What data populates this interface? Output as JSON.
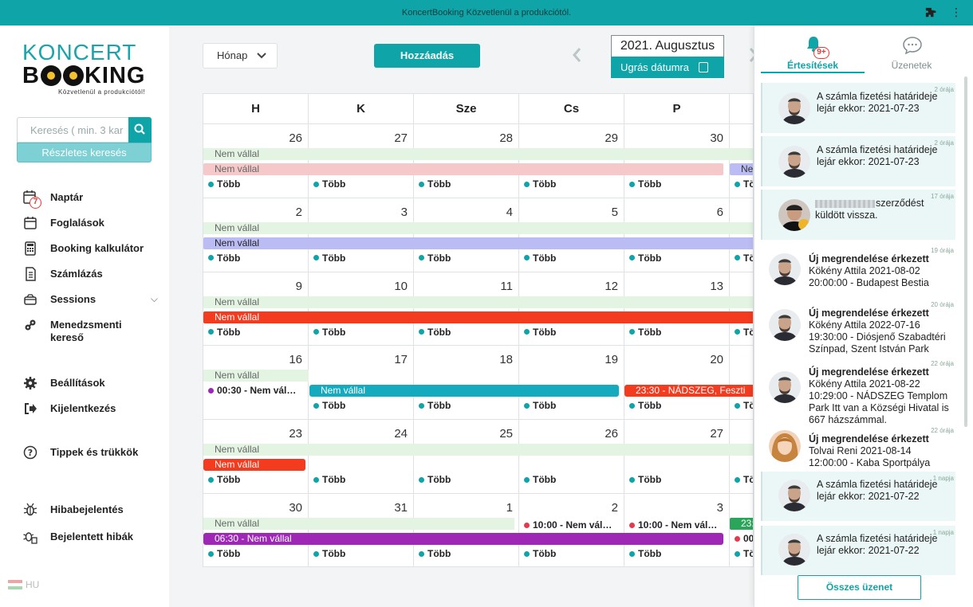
{
  "topbar": {
    "text": "KoncertBooking Közvetlenül a produkciótól.",
    "extension_icon": "puzzle-icon",
    "menu_icon": "kebab-icon"
  },
  "logo": {
    "line1": "KONCERT",
    "line2_a": "B",
    "line2_b": "KING",
    "tagline": "Közvetlenül a produkciótól!"
  },
  "search": {
    "placeholder": "Keresés ( min. 3 kar",
    "advanced_label": "Részletes keresés"
  },
  "nav": {
    "naptar": "Naptár",
    "naptar_badge": "7",
    "foglalasok": "Foglalások",
    "kalkulator": "Booking kalkulátor",
    "szamlazas": "Számlázás",
    "sessions": "Sessions",
    "menedzsment": "Menedzsmenti kereső",
    "beallitasok": "Beállítások",
    "kijelentkezes": "Kijelentkezés",
    "tippek": "Tippek és trükkök",
    "hiba": "Hibabejelentés",
    "bejelentett": "Bejelentett hibák"
  },
  "lang": "HU",
  "toolbar": {
    "view": "Hónap",
    "add": "Hozzáadás",
    "month": "2021. Augusztus",
    "jump": "Ugrás dátumra"
  },
  "calendar": {
    "days": [
      "H",
      "K",
      "Sze",
      "Cs",
      "P"
    ],
    "weeks": [
      [
        "26",
        "27",
        "28",
        "29",
        "30"
      ],
      [
        "2",
        "3",
        "4",
        "5",
        "6"
      ],
      [
        "9",
        "10",
        "11",
        "12",
        "13"
      ],
      [
        "16",
        "17",
        "18",
        "19",
        "20"
      ],
      [
        "23",
        "24",
        "25",
        "26",
        "27"
      ],
      [
        "30",
        "31",
        "1",
        "2",
        "3"
      ]
    ],
    "more": "Több",
    "not_accept": "Nem vállal",
    "partial_ne": "Ne",
    "partial_to": "Tö",
    "w4_event": "00:30 - Nem vál…",
    "w4_mid": "Nem vállal",
    "w4_red": "23:30 - NÁDSZEG, Feszti",
    "w6_purple": "06:30 - Nem vállal",
    "w6_ev1": "10:00 - Nem vál…",
    "w6_ev2": "10:00 - Nem vál…",
    "w6_green": "23:",
    "w6_cut": "00"
  },
  "colors": {
    "teal": "#0fa5a8",
    "green_bar": "#e3f4e3",
    "pink_bar": "#f5c8c9",
    "lavender_bar": "#bcbcf5",
    "red_bar": "#f23b1f",
    "blue_bar": "#16aabf",
    "purple_bar": "#9e27b5"
  },
  "panel": {
    "tab_notif": "Értesítések",
    "tab_notif_badge": "9+",
    "tab_msg": "Üzenetek",
    "notes": [
      {
        "time": "2 órája",
        "text": "A számla fizetési határideje lejár ekkor: 2021-07-23"
      },
      {
        "time": "2 órája",
        "text": "A számla fizetési határideje lejár ekkor: 2021-07-23"
      },
      {
        "time": "17 órája",
        "text": "szerződést küldött vissza."
      },
      {
        "time": "19 órája",
        "title": "Új megrendelése érkezett",
        "text": "Kökény Attila 2021-08-02 20:00:00 - Budapest Bestia"
      },
      {
        "time": "20 órája",
        "title": "Új megrendelése érkezett",
        "text": "Kökény Attila 2022-07-16 19:30:00 - Diósjenő Szabadtéri Színpad, Szent István Park"
      },
      {
        "time": "22 órája",
        "title": "Új megrendelése érkezett",
        "text": "Kökény Attila 2021-08-22 10:29:00 - NÁDSZEG Templom Park Itt van a Községi Hivatal is 667 házszámmal."
      },
      {
        "time": "22 órája",
        "title": "Új megrendelése érkezett",
        "text": "Tolvai Reni 2021-08-14 12:00:00 - Kaba Sportpálya"
      },
      {
        "time": "1 napja",
        "text": "A számla fizetési határideje lejár ekkor: 2021-07-22"
      },
      {
        "time": "1 napja",
        "text": "A számla fizetési határideje lejár ekkor: 2021-07-22"
      }
    ],
    "all_btn": "Összes üzenet"
  }
}
